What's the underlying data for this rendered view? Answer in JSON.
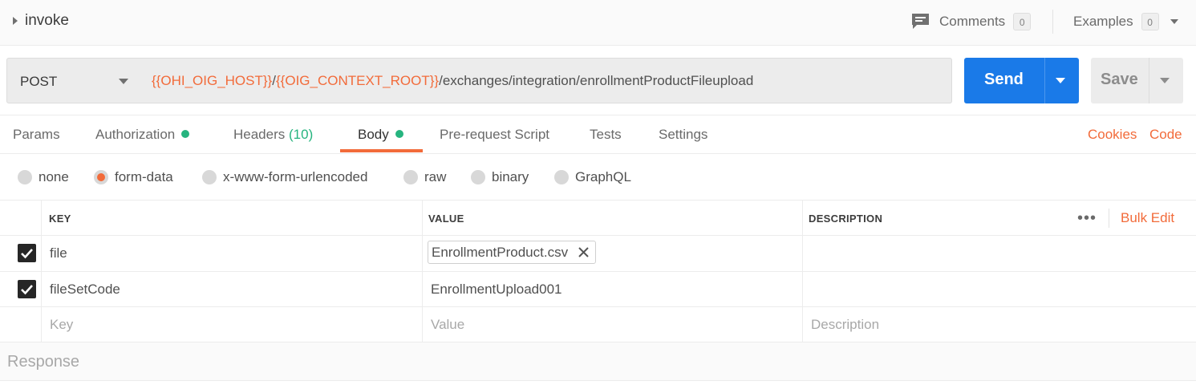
{
  "titlebar": {
    "title": "invoke",
    "comments_label": "Comments",
    "comments_count": "0",
    "examples_label": "Examples",
    "examples_count": "0"
  },
  "request": {
    "method": "POST",
    "url_var1": "{{OHI_OIG_HOST}}",
    "url_sep": "/",
    "url_var2": "{{OIG_CONTEXT_ROOT}}",
    "url_path": "/exchanges/integration/enrollmentProductFileupload",
    "send_label": "Send",
    "save_label": "Save"
  },
  "tabs": {
    "params": "Params",
    "authorization": "Authorization",
    "headers": "Headers",
    "headers_count": "(10)",
    "body": "Body",
    "prerequest": "Pre-request Script",
    "tests": "Tests",
    "settings": "Settings",
    "cookies": "Cookies",
    "code": "Code"
  },
  "body_types": {
    "none": "none",
    "form_data": "form-data",
    "urlencoded": "x-www-form-urlencoded",
    "raw": "raw",
    "binary": "binary",
    "graphql": "GraphQL"
  },
  "table": {
    "headers": {
      "key": "KEY",
      "value": "VALUE",
      "description": "DESCRIPTION"
    },
    "more": "•••",
    "bulk_edit": "Bulk Edit",
    "rows": [
      {
        "key": "file",
        "value": "EnrollmentProduct.csv"
      },
      {
        "key": "fileSetCode",
        "value": "EnrollmentUpload001"
      }
    ],
    "placeholders": {
      "key": "Key",
      "value": "Value",
      "description": "Description"
    }
  },
  "response": {
    "label": "Response"
  },
  "colors": {
    "accent": "#f26b3a",
    "send_blue": "#1a7ae8",
    "green": "#26b47f"
  }
}
